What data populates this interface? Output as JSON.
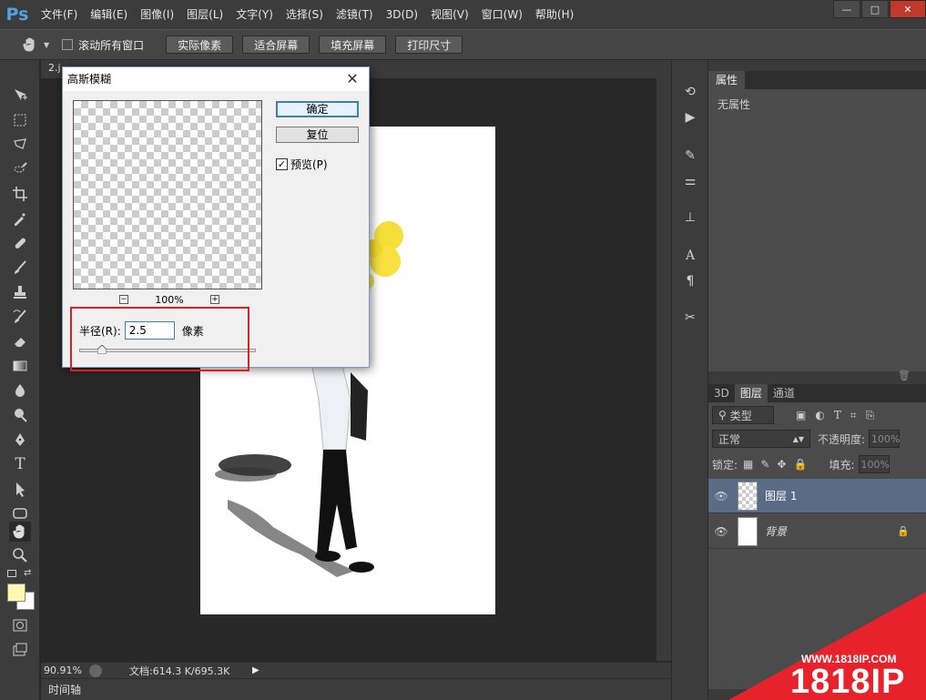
{
  "menubar": {
    "logo": "Ps",
    "items": [
      "文件(F)",
      "编辑(E)",
      "图像(I)",
      "图层(L)",
      "文字(Y)",
      "选择(S)",
      "滤镜(T)",
      "3D(D)",
      "视图(V)",
      "窗口(W)",
      "帮助(H)"
    ]
  },
  "window_controls": {
    "minimize": "—",
    "maximize": "□",
    "close": "✕"
  },
  "options_bar": {
    "scroll_all": "滚动所有窗口",
    "buttons": [
      "实际像素",
      "适合屏幕",
      "填充屏幕",
      "打印尺寸"
    ]
  },
  "document": {
    "tab_label": "2.j",
    "zoom": "90.91%",
    "doc_info": "文档:614.3 K/695.3K"
  },
  "timeline": {
    "label": "时间轴"
  },
  "properties_panel": {
    "tab": "属性",
    "empty_text": "无属性"
  },
  "layers_panel": {
    "tabs": [
      "3D",
      "图层",
      "通道"
    ],
    "filter_kind": "类型",
    "blend_mode": "正常",
    "opacity_label": "不透明度:",
    "opacity_value": "100%",
    "lock_label": "锁定:",
    "fill_label": "填充:",
    "fill_value": "100%",
    "layers": [
      {
        "name": "图层 1",
        "selected": true
      },
      {
        "name": "背景",
        "selected": false
      }
    ]
  },
  "dialog": {
    "title": "高斯模糊",
    "ok": "确定",
    "reset": "复位",
    "preview_label": "预览(P)",
    "preview_checked": true,
    "zoom": "100%",
    "radius_label": "半径(R):",
    "radius_value": "2.5",
    "radius_unit": "像素",
    "radius_slider_fraction": 0.13
  },
  "watermark": {
    "url": "WWW.1818IP.COM",
    "brand": "1818IP"
  },
  "colors": {
    "accent_blue": "#4fa3e0",
    "highlight_red": "#e02020",
    "selected_layer": "#5a6b85",
    "watermark_red": "#e8222a"
  }
}
